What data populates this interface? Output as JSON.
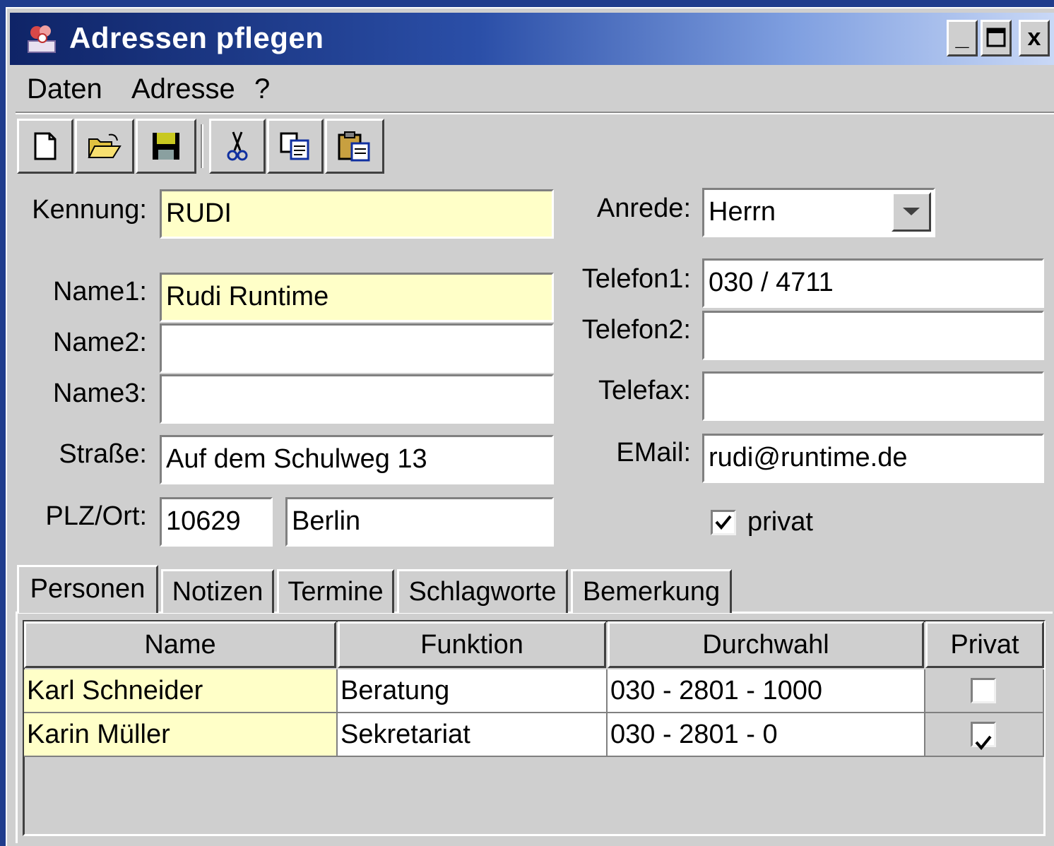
{
  "window": {
    "title": "Adressen pflegen",
    "controls": [
      "_",
      "☐",
      "x"
    ]
  },
  "menu": [
    "Daten",
    "Adresse",
    "?"
  ],
  "toolbar": [
    "new-icon",
    "open-icon",
    "save-icon",
    "cut-icon",
    "copy-icon",
    "paste-icon"
  ],
  "form": {
    "kennung": {
      "label": "Kennung:",
      "value": "RUDI"
    },
    "name1": {
      "label": "Name1:",
      "value": "Rudi Runtime"
    },
    "name2": {
      "label": "Name2:",
      "value": ""
    },
    "name3": {
      "label": "Name3:",
      "value": ""
    },
    "strasse": {
      "label": "Straße:",
      "value": "Auf dem Schulweg 13"
    },
    "plzort": {
      "label": "PLZ/Ort:",
      "plz": "10629",
      "ort": "Berlin"
    },
    "anrede": {
      "label": "Anrede:",
      "value": "Herrn"
    },
    "telefon1": {
      "label": "Telefon1:",
      "value": "030 / 4711"
    },
    "telefon2": {
      "label": "Telefon2:",
      "value": ""
    },
    "telefax": {
      "label": "Telefax:",
      "value": ""
    },
    "email": {
      "label": "EMail:",
      "value": "rudi@runtime.de"
    },
    "privat": {
      "label": "privat",
      "checked": true
    }
  },
  "tabs": [
    "Personen",
    "Notizen",
    "Termine",
    "Schlagworte",
    "Bemerkung"
  ],
  "table": {
    "columns": [
      "Name",
      "Funktion",
      "Durchwahl",
      "Privat"
    ],
    "rows": [
      {
        "name": "Karl Schneider",
        "funktion": "Beratung",
        "durchwahl": "030 - 2801 - 1000",
        "privat": false
      },
      {
        "name": "Karin Müller",
        "funktion": "Sekretariat",
        "durchwahl": "030 - 2801 - 0",
        "privat": true
      }
    ]
  },
  "colors": {
    "required_field": "#ffffc8",
    "window_bg": "#cfcfcf",
    "titlebar_start": "#0f2467"
  }
}
